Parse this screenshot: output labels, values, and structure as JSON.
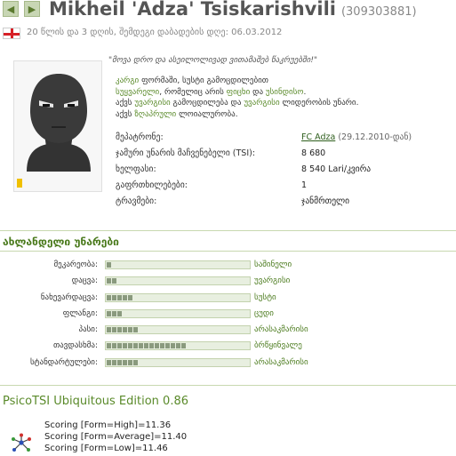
{
  "player": {
    "name": "Mikheil 'Adza' Tsiskarishvili",
    "id": "(309303881)",
    "age_line": "20 წლის და 3 დღის, შემდეგი დაბადების დღე: 06.03.2012"
  },
  "icons": {
    "prev": "arrow-left-icon",
    "next": "arrow-right-icon",
    "flag": "georgia-flag-icon",
    "avatar": "player-avatar-silhouette",
    "psico": "psicotsi-molecule-icon"
  },
  "colors": {
    "accent": "#4a7a1c",
    "link": "#2e5e1c",
    "bar_fill": "#8a9a7e",
    "bar_bg": "#e8efe0",
    "marker": "#f0c000"
  },
  "profile": {
    "quote": "\"მოვა დრო და ასეილოლივად ვითამაშებ წაკრუებში!\"",
    "desc_lines": [
      [
        "კარგი",
        " ფორმაში, სუსტი გამოცდილებით"
      ],
      [
        "სუყვარელი",
        ", რომელიც არის ",
        "ფიცხი",
        " და ",
        "უსინდისო",
        "."
      ],
      [
        "აქვს ",
        "უვარგისი",
        " გამოცდილება და ",
        "უვარგისი",
        " ლიდერობის უნარი."
      ],
      [
        "აქვს ",
        "ზღაპრული",
        " ლოიალურობა."
      ]
    ]
  },
  "info": [
    {
      "label": "მეპატრონე:",
      "value": "FC Adza",
      "sub": "(29.12.2010-დან)"
    },
    {
      "label": "ჯამური უნარის მაჩვენებელი (TSI):",
      "value": "8 680"
    },
    {
      "label": "ხელფასი:",
      "value": "8 540 Lari/კვირა"
    },
    {
      "label": "გაფრთხილებები:",
      "value": "1"
    },
    {
      "label": "ტრავმები:",
      "value": "ჯანმრთელი"
    }
  ],
  "skills_title": "ახლანდელი უნარები",
  "skills": [
    {
      "name": "მეკარეობა:",
      "level_text": "საშინელი",
      "level": 1
    },
    {
      "name": "დაცვა:",
      "level_text": "უვარგისი",
      "level": 2
    },
    {
      "name": "ნახევარდაცვა:",
      "level_text": "სუსტი",
      "level": 5
    },
    {
      "name": "ფლანგი:",
      "level_text": "ცუდი",
      "level": 3
    },
    {
      "name": "პასი:",
      "level_text": "არასაკმარისი",
      "level": 6
    },
    {
      "name": "თავდასხმა:",
      "level_text": "ბრწყინვალე",
      "level": 15
    },
    {
      "name": "სტანდარტულები:",
      "level_text": "არასაკმარისი",
      "level": 6
    }
  ],
  "psico": {
    "title": "PsicoTSI Ubiquitous Edition 0.86",
    "scores": [
      "Scoring [Form=High]=11.36",
      "Scoring [Form=Average]=11.40",
      "Scoring [Form=Low]=11.46"
    ]
  }
}
